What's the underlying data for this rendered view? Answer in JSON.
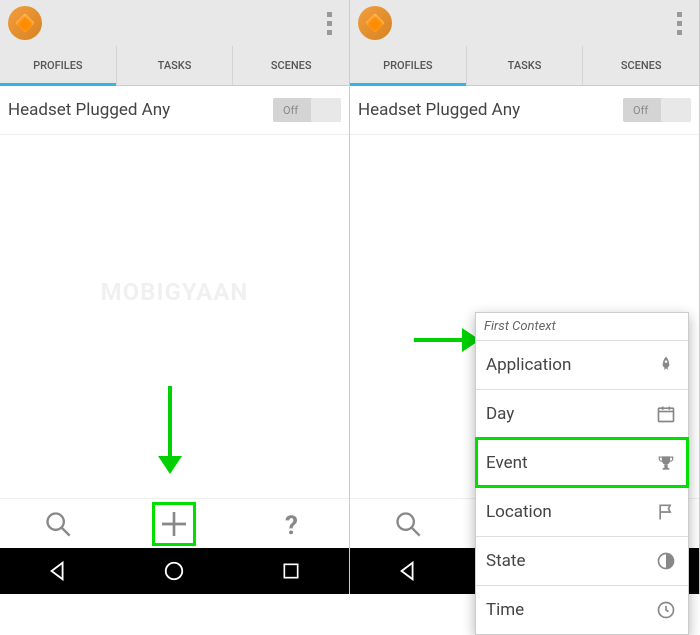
{
  "tabs": {
    "profiles": "PROFILES",
    "tasks": "TASKS",
    "scenes": "SCENES"
  },
  "profile": {
    "name": "Headset Plugged Any",
    "toggle": "Off"
  },
  "context_menu": {
    "title": "First Context",
    "items": {
      "application": "Application",
      "day": "Day",
      "event": "Event",
      "location": "Location",
      "state": "State",
      "time": "Time"
    }
  },
  "watermark": "MOBIGYAAN"
}
